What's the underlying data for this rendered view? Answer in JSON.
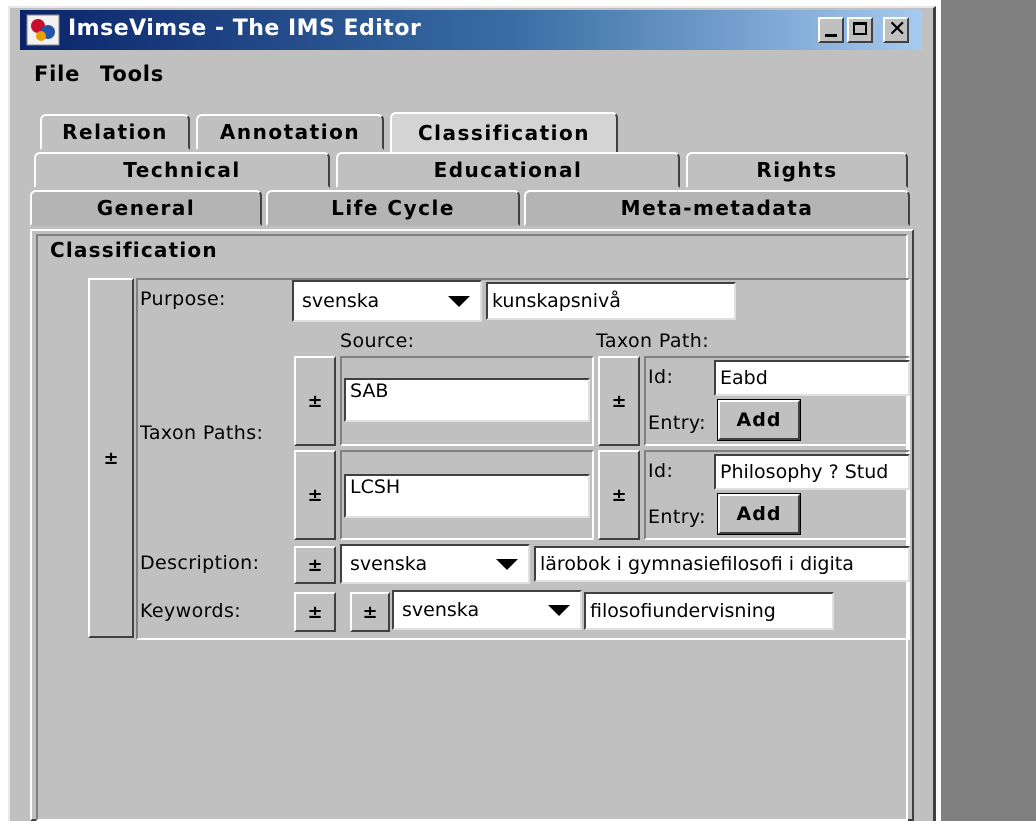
{
  "window": {
    "title": "ImseVimse - The IMS Editor",
    "controls": {
      "minimize": "_",
      "maximize": "□",
      "close": "X"
    }
  },
  "menu": [
    "File",
    "Tools"
  ],
  "tabs": {
    "row1": [
      "Relation",
      "Annotation",
      "Classification"
    ],
    "row2": [
      "Technical",
      "Educational",
      "Rights"
    ],
    "row3": [
      "General",
      "Life Cycle",
      "Meta-metadata"
    ],
    "active": "Classification"
  },
  "panel": {
    "title": "Classification",
    "outer_toggle": "±",
    "purpose": {
      "label": "Purpose:",
      "language": "svenska",
      "value": "kunskapsnivå"
    },
    "taxon_paths": {
      "label": "Taxon Paths:",
      "source_header": "Source:",
      "taxon_header": "Taxon Path:",
      "entries": [
        {
          "toggle": "±",
          "source": "SAB",
          "taxon_toggle": "±",
          "id_label": "Id:",
          "id": "Eabd",
          "entry_label": "Entry:",
          "add_label": "Add"
        },
        {
          "toggle": "±",
          "source": "LCSH",
          "taxon_toggle": "±",
          "id_label": "Id:",
          "id": "Philosophy ? Stud",
          "entry_label": "Entry:",
          "add_label": "Add"
        }
      ]
    },
    "description": {
      "label": "Description:",
      "toggle": "±",
      "language": "svenska",
      "value": "lärobok i gymnasiefilosofi i digita"
    },
    "keywords": {
      "label": "Keywords:",
      "toggle": "±",
      "inner_toggle": "±",
      "language": "svenska",
      "value": "filosofiundervisning"
    }
  },
  "colors": {
    "title_gradient_start": "#0a246a",
    "title_gradient_end": "#a6caf0",
    "window_bg": "#c0c0c0"
  },
  "icons": {
    "app": "imsevimse-app-icon"
  }
}
